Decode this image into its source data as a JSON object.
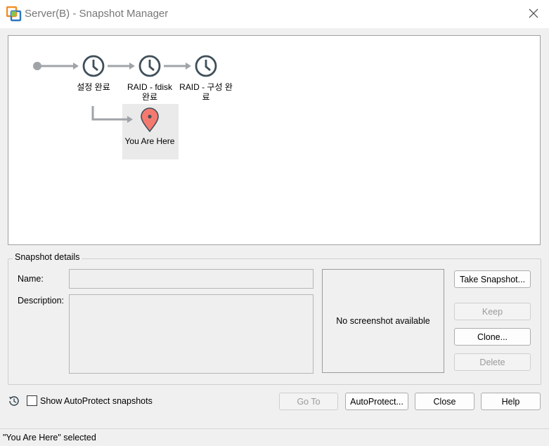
{
  "window": {
    "title": "Server(B) - Snapshot Manager"
  },
  "tree": {
    "nodes": [
      {
        "label": "설정 완료"
      },
      {
        "label": "RAID - fdisk\n완료"
      },
      {
        "label": "RAID - 구성 완\n료"
      }
    ],
    "current": {
      "label": "You Are Here"
    }
  },
  "details": {
    "group_title": "Snapshot details",
    "name_label": "Name:",
    "name_value": "",
    "description_label": "Description:",
    "description_value": "",
    "preview_text": "No screenshot available"
  },
  "buttons": {
    "take_snapshot": "Take Snapshot...",
    "keep": "Keep",
    "clone": "Clone...",
    "delete": "Delete",
    "go_to": "Go To",
    "autoprotect": "AutoProtect...",
    "close": "Close",
    "help": "Help"
  },
  "footer": {
    "show_autoprotect_label": "Show AutoProtect snapshots",
    "show_autoprotect_checked": false
  },
  "status": {
    "text": "\"You Are Here\" selected"
  },
  "colors": {
    "accent_marker": "#f47a70",
    "clock": "#3f4f5a",
    "arrow": "#a0a4a8"
  }
}
